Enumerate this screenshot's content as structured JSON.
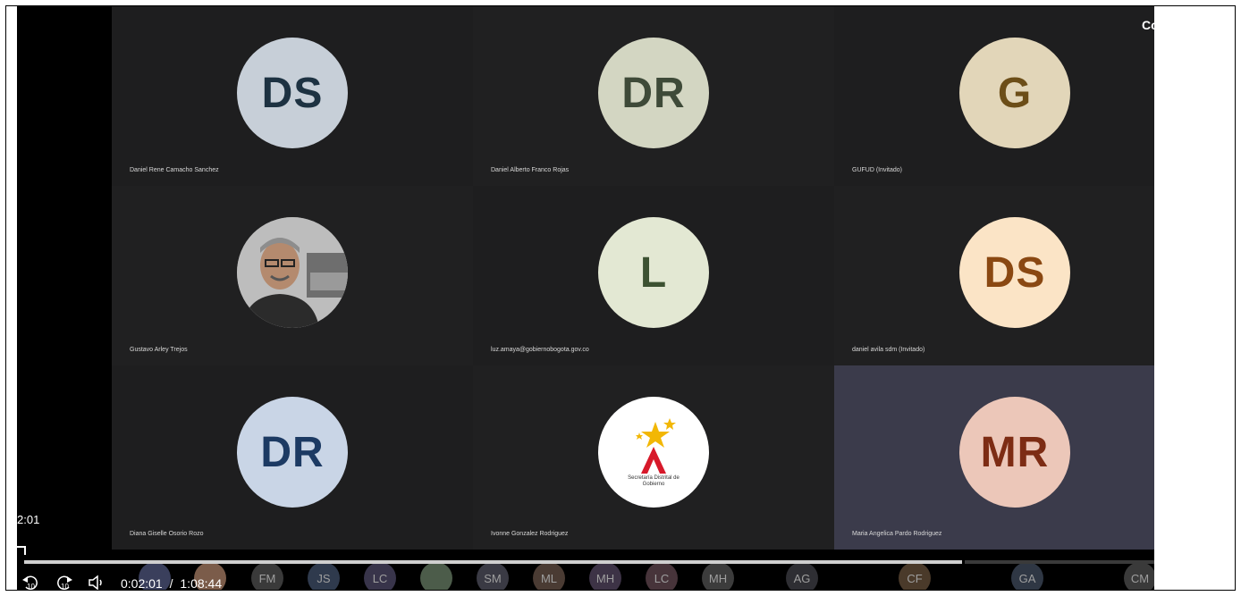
{
  "corner_label": "Co",
  "left_time": "2:01",
  "tiles": [
    {
      "name": "Daniel Rene Camacho Sanchez",
      "initials": "DS",
      "bg": "#c7cfd8",
      "fg": "#1d3242"
    },
    {
      "name": "Daniel Alberto Franco Rojas",
      "initials": "DR",
      "bg": "#d3d6c2",
      "fg": "#3e4a38"
    },
    {
      "name": "GUFUD (Invitado)",
      "initials": "G",
      "bg": "#e2d6b9",
      "fg": "#6c4e18"
    },
    {
      "name": "Gustavo Arley Trejos",
      "initials": "",
      "bg": "#8a8a8a",
      "fg": "#ffffff"
    },
    {
      "name": "luz.amaya@gobiernobogota.gov.co",
      "initials": "L",
      "bg": "#e3e8d3",
      "fg": "#3d5232"
    },
    {
      "name": "daniel avila sdm (Invitado)",
      "initials": "DS",
      "bg": "#fbe4c6",
      "fg": "#8a4812"
    },
    {
      "name": "Diana Giselle Osorio Rozo",
      "initials": "DR",
      "bg": "#c9d5e6",
      "fg": "#1c3a63"
    },
    {
      "name": "Ivonne Gonzalez Rodriguez",
      "initials": "",
      "bg": "#ffffff",
      "fg": "#000000"
    },
    {
      "name": "Maria Angelica Pardo Rodriguez",
      "initials": "MR",
      "bg": "#ecc7b9",
      "fg": "#7d2c14"
    }
  ],
  "logo_text": "Secretaría Distrital de Gobierno",
  "participants_strip": [
    {
      "initials": "",
      "bg": "#3a3f5c"
    },
    {
      "initials": "",
      "bg": "#7b5c4a"
    },
    {
      "initials": "FM",
      "bg": "#3a3a3a"
    },
    {
      "initials": "JS",
      "bg": "#2f3a4d"
    },
    {
      "initials": "LC",
      "bg": "#38344a"
    },
    {
      "initials": "",
      "bg": "#4c5c4a"
    },
    {
      "initials": "SM",
      "bg": "#3a3a44"
    },
    {
      "initials": "ML",
      "bg": "#4a3b33"
    },
    {
      "initials": "MH",
      "bg": "#3d3346"
    },
    {
      "initials": "LC",
      "bg": "#47343a"
    },
    {
      "initials": "MH",
      "bg": "#3c3c3c"
    },
    {
      "initials": "AG",
      "bg": "#2e2e33"
    },
    {
      "initials": "CF",
      "bg": "#4a3a2a"
    },
    {
      "initials": "GA",
      "bg": "#2f3744"
    },
    {
      "initials": "CM",
      "bg": "#3a3a3a"
    }
  ],
  "player": {
    "current_time": "0:02:01",
    "separator": "/",
    "total_time": "1:08:44",
    "rewind_label": "10",
    "forward_label": "10",
    "progress": 0.83
  }
}
